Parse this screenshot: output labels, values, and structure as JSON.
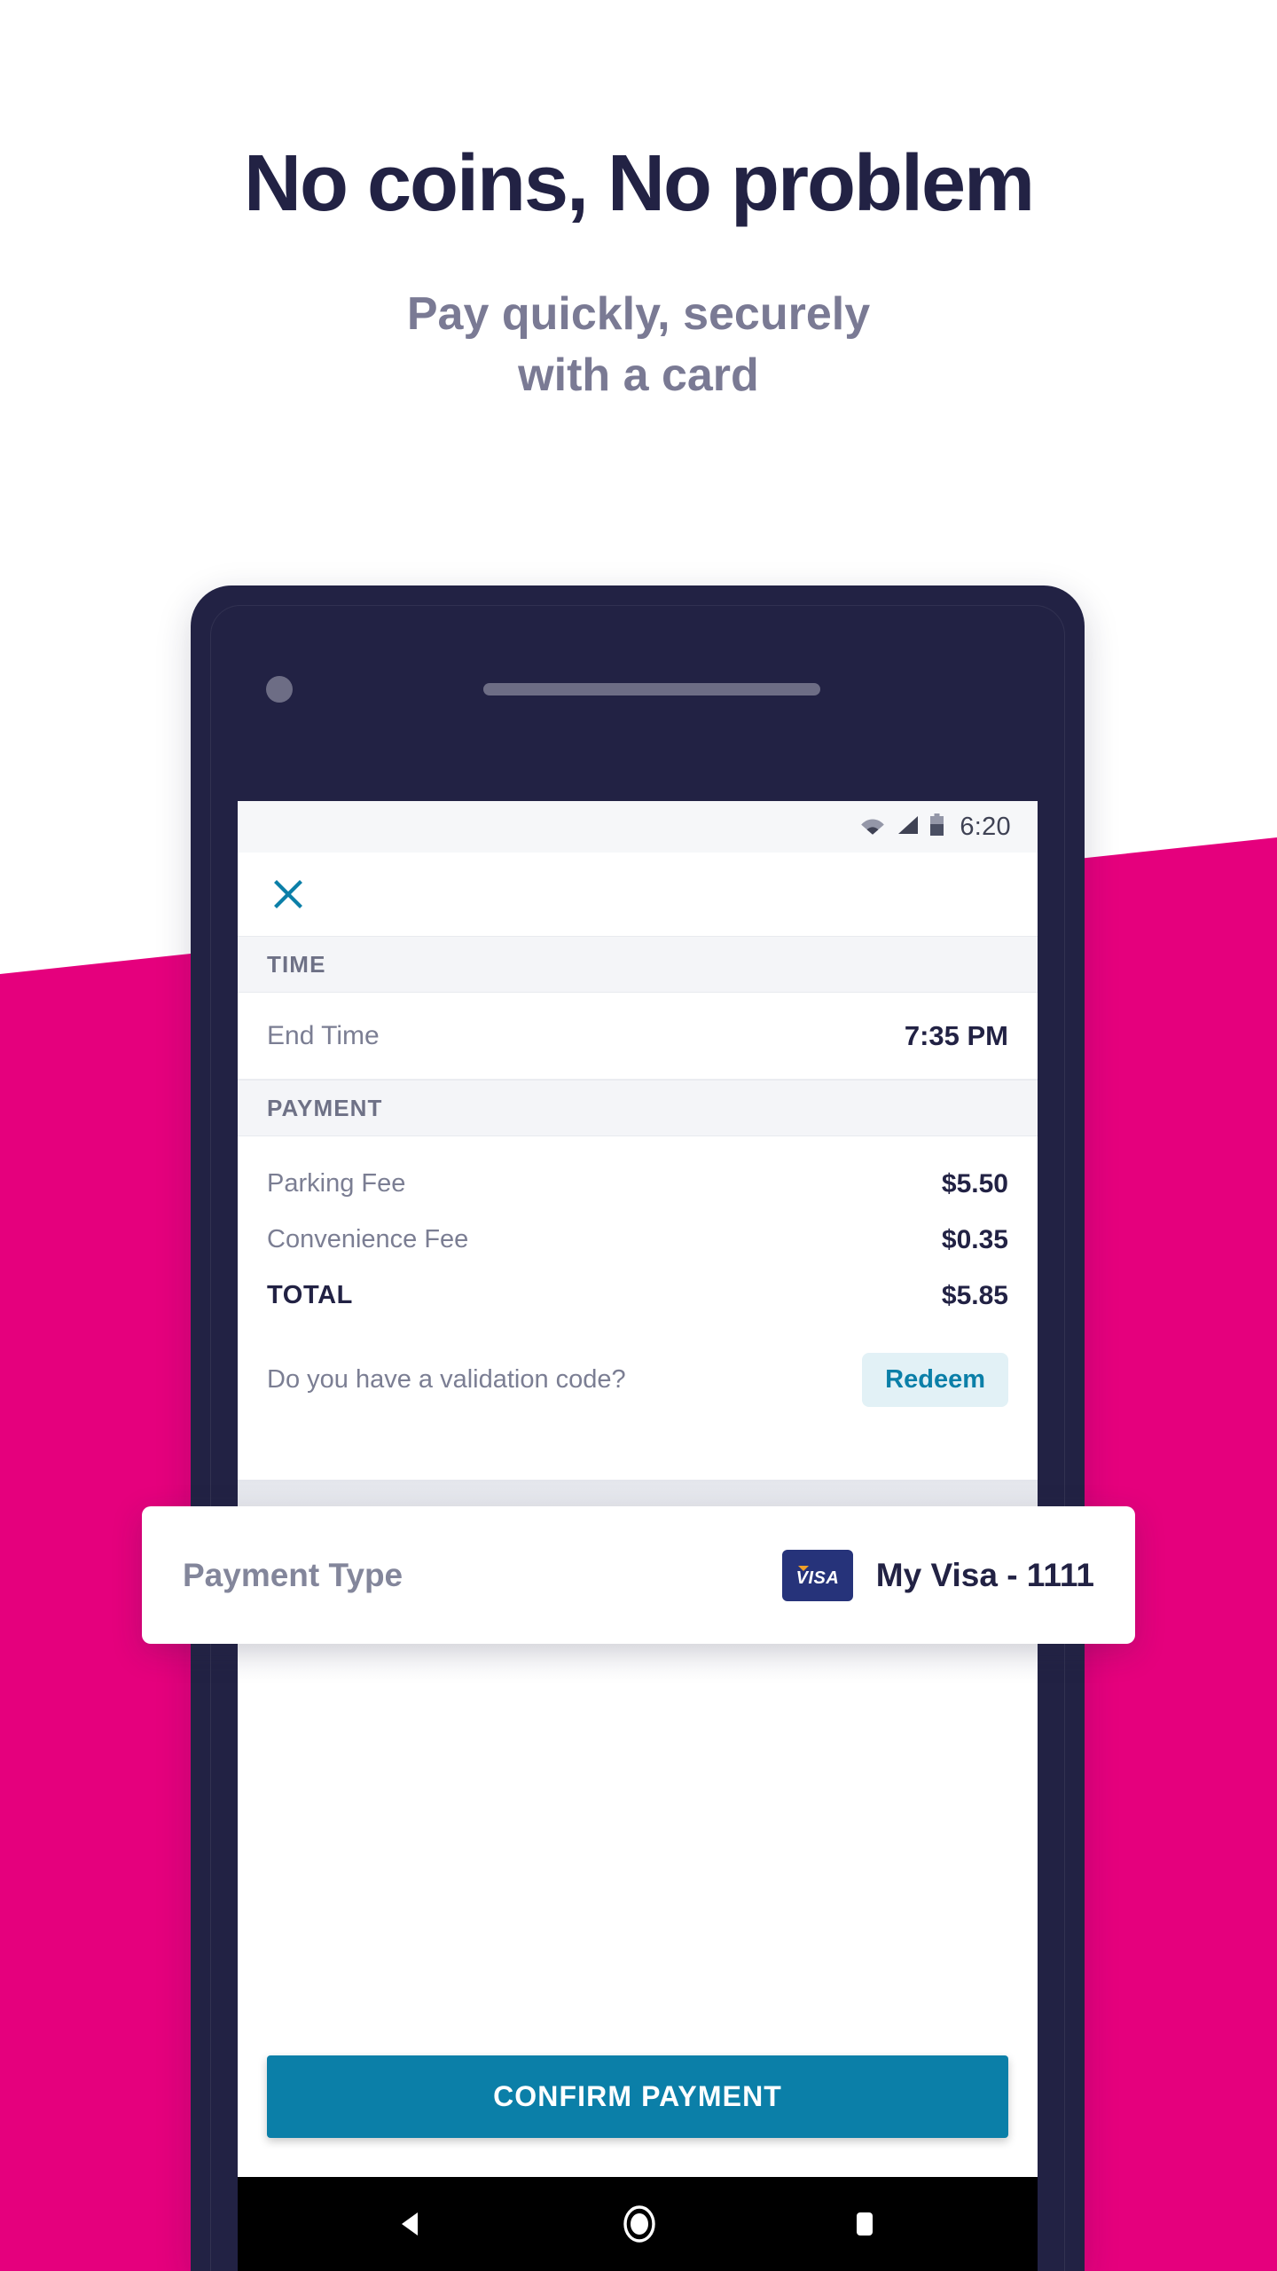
{
  "promo": {
    "headline": "No coins, No problem",
    "subtitle_line1": "Pay quickly, securely",
    "subtitle_line2": "with a card"
  },
  "colors": {
    "background": "#ffffff",
    "accent_magenta": "#e5007d",
    "headline_navy": "#222244",
    "subtitle_gray": "#7a7a94",
    "teal_action": "#0b7fa8",
    "redeem_bg": "#e2f1f6",
    "phone_frame": "#222244",
    "visa_navy": "#26337a",
    "visa_gold": "#f0a028"
  },
  "phone": {
    "status_bar": {
      "time": "6:20",
      "icons": [
        "wifi-icon",
        "cellular-signal-icon",
        "battery-icon"
      ]
    },
    "app_bar": {
      "close_icon": "close-icon"
    },
    "sections": [
      {
        "header": "TIME",
        "rows": [
          {
            "label": "End Time",
            "value": "7:35 PM"
          }
        ]
      },
      {
        "header": "PAYMENT",
        "rows": [
          {
            "label": "Parking Fee",
            "value": "$5.50",
            "emphasis": false
          },
          {
            "label": "Convenience Fee",
            "value": "$0.35",
            "emphasis": false
          },
          {
            "label": "TOTAL",
            "value": "$5.85",
            "emphasis": true
          }
        ]
      }
    ],
    "validation": {
      "prompt": "Do you have a validation code?",
      "redeem_label": "Redeem"
    },
    "payment_type": {
      "label": "Payment Type",
      "card_brand": "VISA",
      "card_name": "My Visa - 1111"
    },
    "confirm_label": "CONFIRM PAYMENT",
    "nav_bar": {
      "back": "back-triangle-icon",
      "home": "home-circle-icon",
      "recents": "recents-square-icon"
    }
  }
}
